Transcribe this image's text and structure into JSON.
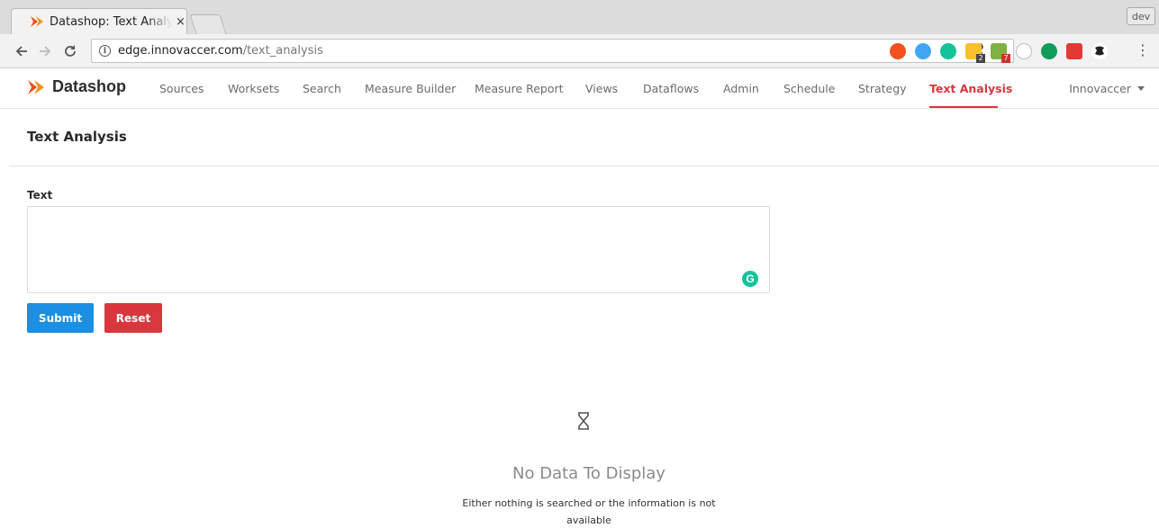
{
  "browser": {
    "tab_title": "Datashop: Text Analysis",
    "tab_close": "×",
    "profile_label": "dev",
    "url_host": "edge.innovaccer.com",
    "url_path": "/text_analysis",
    "icons": [
      "back-icon",
      "forward-icon",
      "reload-icon",
      "site-info-icon",
      "key-icon",
      "star-icon"
    ],
    "extensions": [
      {
        "name": "extension-infinity-icon",
        "color": "#f4511e"
      },
      {
        "name": "extension-blue-icon",
        "color": "#42a5f5"
      },
      {
        "name": "grammarly-extension-icon",
        "color": "#15c39a"
      },
      {
        "name": "extension-yellow-icon",
        "color": "#fbc02d",
        "badge": "2"
      },
      {
        "name": "extension-green-icon",
        "color": "#7cb342",
        "badge": "7"
      },
      {
        "name": "extension-gray-icon",
        "color": "#bdbdbd"
      },
      {
        "name": "hangouts-icon",
        "color": "#0f9d58"
      },
      {
        "name": "extension-red-icon",
        "color": "#e53935"
      },
      {
        "name": "extension-black-icon",
        "color": "#222222"
      }
    ]
  },
  "app": {
    "brand": "Datashop",
    "brand_color": "#e94e1b",
    "accent_color": "#d9363e",
    "nav": [
      {
        "label": "Sources",
        "active": false
      },
      {
        "label": "Worksets",
        "active": false
      },
      {
        "label": "Search",
        "active": false
      },
      {
        "label": "Measure Builder",
        "active": false
      },
      {
        "label": "Measure Report",
        "active": false
      },
      {
        "label": "Views",
        "active": false
      },
      {
        "label": "Dataflows",
        "active": false
      },
      {
        "label": "Admin",
        "active": false
      },
      {
        "label": "Schedule",
        "active": false
      },
      {
        "label": "Strategy",
        "active": false
      },
      {
        "label": "Text Analysis",
        "active": true
      }
    ],
    "user": "Innovaccer"
  },
  "page": {
    "title": "Text Analysis",
    "field_label": "Text",
    "text_value": "",
    "submit_label": "Submit",
    "submit_color": "#1a8fe3",
    "reset_label": "Reset",
    "reset_color": "#d9363e",
    "empty_icon": "hourglass-icon",
    "empty_title": "No Data To Display",
    "empty_desc": "Either nothing is searched or the information is not available"
  }
}
